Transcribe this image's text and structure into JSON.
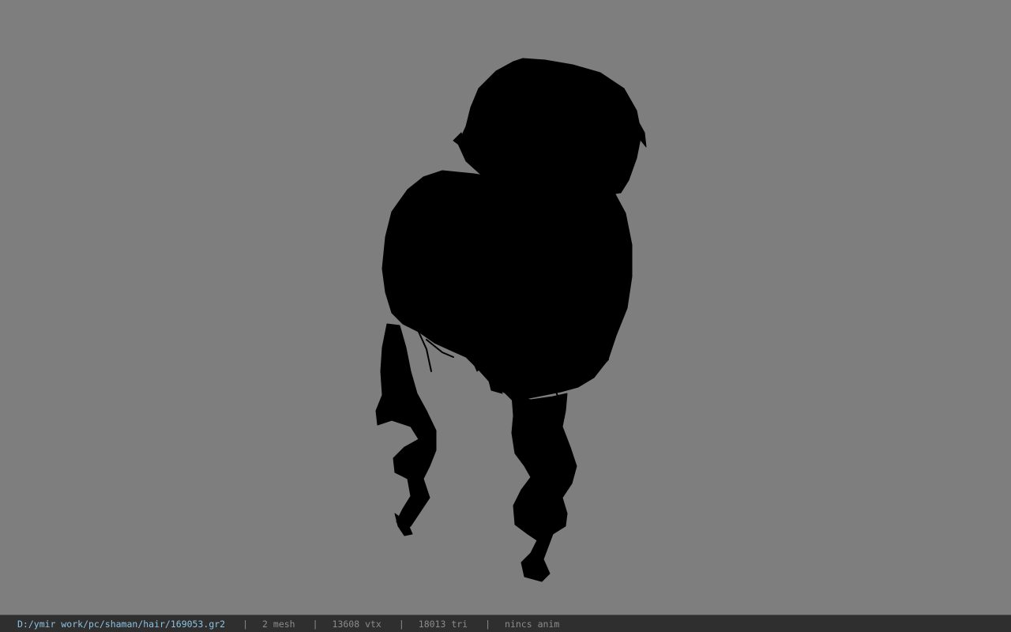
{
  "viewport": {
    "background_color": "#7e7e7e",
    "model_color": "#000000",
    "model_name": "hair-model-silhouette"
  },
  "statusbar": {
    "file_path": "D:/ymir work/pc/shaman/hair/169053.gr2",
    "separator": "|",
    "mesh_count": "2 mesh",
    "vertex_count": "13608 vtx",
    "triangle_count": "18013 tri",
    "anim_status": "nincs anim"
  }
}
